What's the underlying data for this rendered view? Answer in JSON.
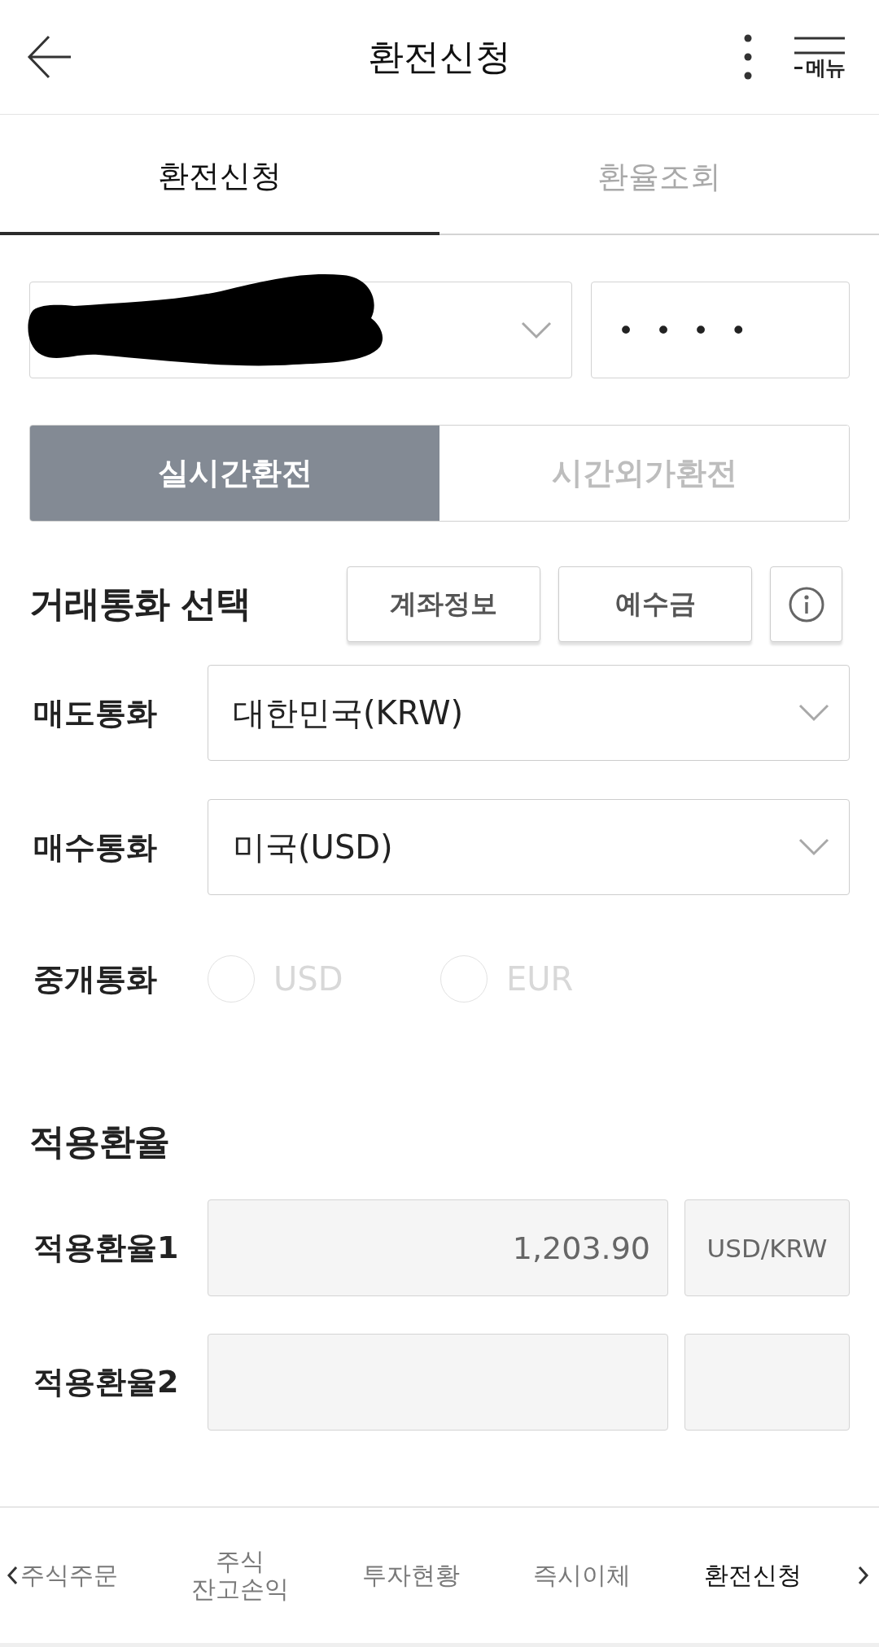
{
  "header": {
    "title": "환전신청",
    "menu_label": "메뉴"
  },
  "tabs": [
    {
      "label": "환전신청",
      "selected": true
    },
    {
      "label": "환율조회",
      "selected": false
    }
  ],
  "account": {
    "redacted": true,
    "password": {
      "value": "••••"
    }
  },
  "exchange_modes": [
    {
      "label": "실시간환전",
      "selected": true
    },
    {
      "label": "시간외가환전",
      "selected": false
    }
  ],
  "currency_selection": {
    "title": "거래통화 선택",
    "buttons": [
      "계좌정보",
      "예수금"
    ],
    "fields": [
      {
        "label": "매도통화",
        "value": "대한민국(KRW)"
      },
      {
        "label": "매수통화",
        "value": "미국(USD)"
      }
    ],
    "intermediary": {
      "label": "중개통화",
      "disabled": true,
      "options": [
        {
          "label": "USD",
          "selected": false
        },
        {
          "label": "EUR",
          "selected": false
        }
      ]
    }
  },
  "applied_rates": {
    "title": "적용환율",
    "rows": [
      {
        "label": "적용환율1",
        "value": "1,203.90",
        "unit": "USD/KRW"
      },
      {
        "label": "적용환율2"
      }
    ]
  },
  "bottom_nav": {
    "items": [
      {
        "label": "주식주문",
        "selected": false
      },
      {
        "label": "주식\n잔고손익",
        "selected": false
      },
      {
        "label": "투자현황",
        "selected": false
      },
      {
        "label": "즉시이체",
        "selected": false
      },
      {
        "label": "환전신청",
        "selected": true
      }
    ]
  }
}
